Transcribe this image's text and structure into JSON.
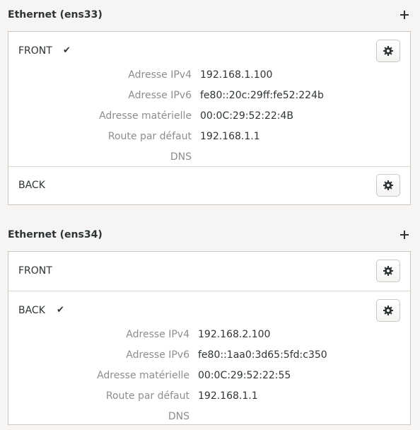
{
  "sections": [
    {
      "title": "Ethernet (ens33)",
      "add_icon": "plus-icon",
      "profiles": [
        {
          "name": "FRONT",
          "active": true,
          "settings_icon": "gear-icon",
          "details": [
            {
              "label": "Adresse IPv4",
              "value": "192.168.1.100"
            },
            {
              "label": "Adresse IPv6",
              "value": "fe80::20c:29ff:fe52:224b"
            },
            {
              "label": "Adresse matérielle",
              "value": "00:0C:29:52:22:4B"
            },
            {
              "label": "Route par défaut",
              "value": "192.168.1.1"
            },
            {
              "label": "DNS",
              "value": ""
            }
          ]
        },
        {
          "name": "BACK",
          "active": false,
          "settings_icon": "gear-icon",
          "details": []
        }
      ]
    },
    {
      "title": "Ethernet (ens34)",
      "add_icon": "plus-icon",
      "profiles": [
        {
          "name": "FRONT",
          "active": false,
          "settings_icon": "gear-icon",
          "details": []
        },
        {
          "name": "BACK",
          "active": true,
          "settings_icon": "gear-icon",
          "details": [
            {
              "label": "Adresse IPv4",
              "value": "192.168.2.100"
            },
            {
              "label": "Adresse IPv6",
              "value": "fe80::1aa0:3d65:5fd:c350"
            },
            {
              "label": "Adresse matérielle",
              "value": "00:0C:29:52:22:55"
            },
            {
              "label": "Route par défaut",
              "value": "192.168.1.1"
            },
            {
              "label": "DNS",
              "value": ""
            }
          ]
        }
      ]
    }
  ]
}
